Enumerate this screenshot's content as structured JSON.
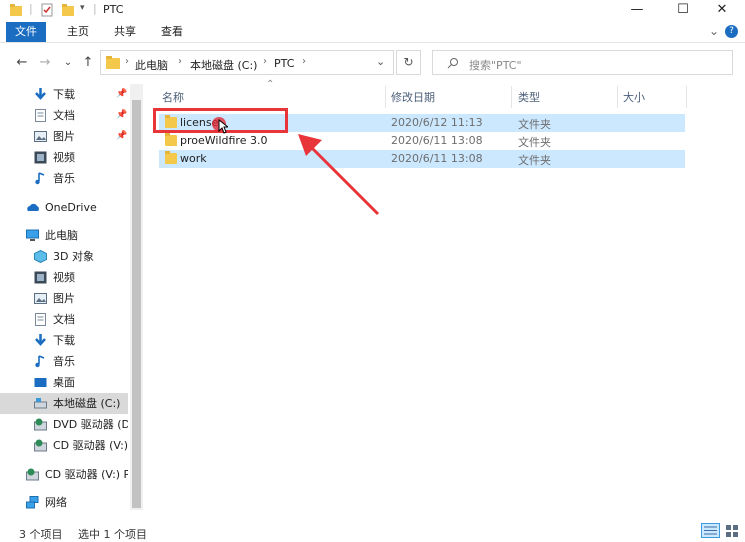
{
  "window": {
    "title": "PTC",
    "minimize": "—",
    "maximize": "☐",
    "close": "✕"
  },
  "ribbon": {
    "tabs": [
      "文件",
      "主页",
      "共享",
      "查看"
    ],
    "expand": "⌄",
    "help": "?"
  },
  "address": {
    "back": "←",
    "forward": "→",
    "recent": "⌄",
    "up": "↑",
    "crumbs": [
      "此电脑",
      "本地磁盘 (C:)",
      "PTC"
    ],
    "dropdown": "⌄",
    "refresh": "↻",
    "search_placeholder": "搜索\"PTC\""
  },
  "sidebar": {
    "items": [
      {
        "label": "下载",
        "icon": "download-icon",
        "pinned": true
      },
      {
        "label": "文档",
        "icon": "document-icon",
        "pinned": true
      },
      {
        "label": "图片",
        "icon": "picture-icon",
        "pinned": true
      },
      {
        "label": "视频",
        "icon": "video-icon",
        "pinned": false
      },
      {
        "label": "音乐",
        "icon": "music-icon",
        "pinned": false
      },
      {
        "label": "OneDrive",
        "icon": "onedrive-icon"
      },
      {
        "label": "此电脑",
        "icon": "this-pc-icon"
      },
      {
        "label": "3D 对象",
        "icon": "3d-objects-icon"
      },
      {
        "label": "视频",
        "icon": "video-icon"
      },
      {
        "label": "图片",
        "icon": "picture-icon"
      },
      {
        "label": "文档",
        "icon": "document-icon"
      },
      {
        "label": "下载",
        "icon": "download-icon"
      },
      {
        "label": "音乐",
        "icon": "music-icon"
      },
      {
        "label": "桌面",
        "icon": "desktop-icon"
      },
      {
        "label": "本地磁盘 (C:)",
        "icon": "local-disk-icon",
        "selected": true
      },
      {
        "label": "DVD 驱动器 (D:",
        "icon": "dvd-drive-icon"
      },
      {
        "label": "CD 驱动器 (V:) I",
        "icon": "cd-drive-icon"
      },
      {
        "label": "CD 驱动器 (V:) Pr",
        "icon": "cd-drive-icon"
      },
      {
        "label": "网络",
        "icon": "network-icon"
      }
    ]
  },
  "columns": {
    "name": "名称",
    "modified": "修改日期",
    "type": "类型",
    "size": "大小"
  },
  "files": [
    {
      "name": "license",
      "modified": "2020/6/12 11:13",
      "type": "文件夹",
      "selected": true
    },
    {
      "name": "proeWildfire 3.0",
      "modified": "2020/6/11 13:08",
      "type": "文件夹",
      "selected": false
    },
    {
      "name": "work",
      "modified": "2020/6/11 13:08",
      "type": "文件夹",
      "selected": true
    }
  ],
  "status": {
    "count": "3 个项目",
    "selected": "选中 1 个项目"
  },
  "colors": {
    "accent": "#1a6dc0",
    "selection": "#cce8ff",
    "annotation": "#e8353a"
  }
}
